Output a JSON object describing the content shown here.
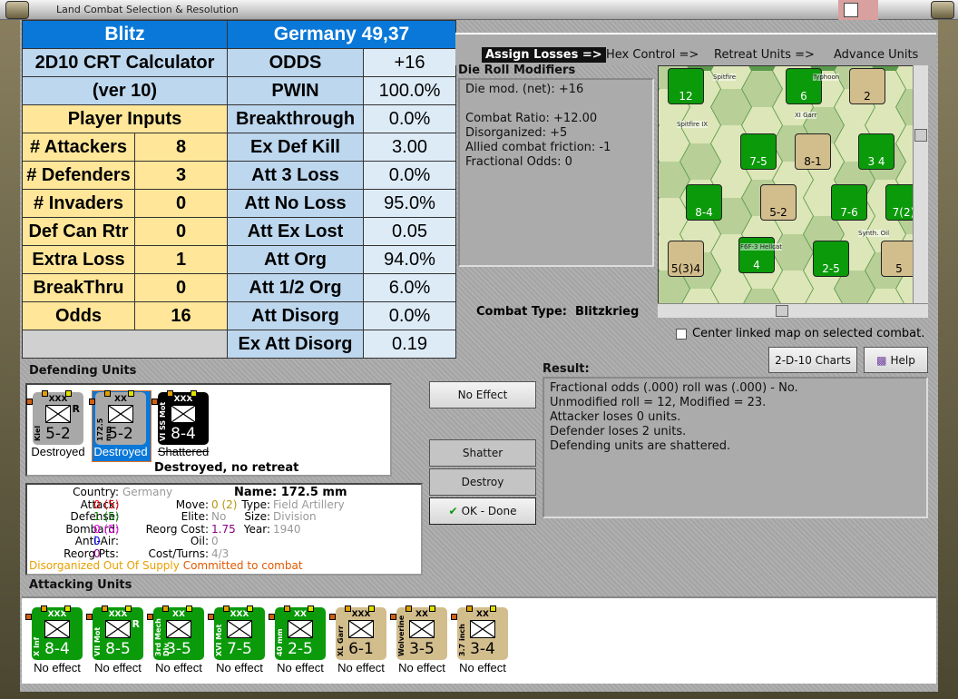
{
  "window": {
    "title": "Land Combat Selection & Resolution"
  },
  "crt": {
    "header_left": "Blitz",
    "header_right": "Germany 49,37",
    "calc_title": "2D10 CRT Calculator",
    "calc_version": "(ver 10)",
    "inputs_header": "Player Inputs",
    "inputs": [
      {
        "label": "# Attackers",
        "value": "8"
      },
      {
        "label": "# Defenders",
        "value": "3"
      },
      {
        "label": "# Invaders",
        "value": "0"
      },
      {
        "label": "Def Can Rtr",
        "value": "0"
      },
      {
        "label": "Extra Loss",
        "value": "1"
      },
      {
        "label": "BreakThru",
        "value": "0"
      },
      {
        "label": "Odds",
        "value": "16"
      }
    ],
    "results": [
      {
        "label": "ODDS",
        "value": "+16"
      },
      {
        "label": "PWIN",
        "value": "100.0%"
      },
      {
        "label": "Breakthrough",
        "value": "0.0%"
      },
      {
        "label": "Ex Def Kill",
        "value": "3.00"
      },
      {
        "label": "Att 3 Loss",
        "value": "0.0%"
      },
      {
        "label": "Att No Loss",
        "value": "95.0%"
      },
      {
        "label": "Att Ex Lost",
        "value": "0.05"
      },
      {
        "label": "Att Org",
        "value": "94.0%"
      },
      {
        "label": "Att 1/2 Org",
        "value": "6.0%"
      },
      {
        "label": "Att Disorg",
        "value": "0.0%"
      },
      {
        "label": "Ex Att Disorg",
        "value": "0.19"
      }
    ]
  },
  "steps": [
    "Assign Losses =>",
    "Hex Control =>",
    "Retreat Units =>",
    "Advance Units"
  ],
  "modifiers": {
    "title": "Die Roll Modifiers",
    "lines": [
      "Die mod. (net): +16",
      "",
      "Combat Ratio: +12.00",
      "Disorganized: +5",
      "Allied combat friction: -1",
      "Fractional Odds: 0"
    ]
  },
  "combat_type": {
    "label": "Combat Type:",
    "value": "Blitzkrieg"
  },
  "center_map": {
    "label": "Center linked map on selected combat.",
    "checked": false
  },
  "buttons": {
    "charts": "2-D-10 Charts",
    "help": "Help",
    "no_effect": "No Effect",
    "shatter": "Shatter",
    "destroy": "Destroy",
    "ok": "OK - Done"
  },
  "result": {
    "title": "Result:",
    "lines": [
      "Fractional odds (.000) roll was (.000)  - No.",
      "Unmodified roll = 12, Modified = 23.",
      "Attacker loses 0 units.",
      "Defender loses 2 units.",
      "Defending units are shattered."
    ]
  },
  "defending": {
    "title": "Defending Units",
    "note": "Destroyed, no retreat",
    "units": [
      {
        "name": "Kiel",
        "size": "XXX",
        "strength": "5-2",
        "status": "Destroyed",
        "reserve": "R",
        "symbol": "M"
      },
      {
        "name": "172.5 mm",
        "size": "XX",
        "strength": "5-2",
        "status": "Destroyed",
        "selected": true
      },
      {
        "name": "VI SS Mot",
        "size": "XXX",
        "strength": "8-4",
        "status": "Shattered"
      }
    ]
  },
  "unit_info": {
    "country": {
      "label": "Country:",
      "value": "Germany"
    },
    "attack": {
      "label": "Attack:",
      "value": "0",
      "base": "(5)"
    },
    "defense": {
      "label": "Defense:",
      "value": "1",
      "base": "(5)"
    },
    "bombard": {
      "label": "Bombard:",
      "value": "0",
      "base": "(5)"
    },
    "anti_air": {
      "label": "Anti-Air:",
      "value": "0"
    },
    "reorg_pts": {
      "label": "Reorg Pts:",
      "value": "0"
    },
    "move": {
      "label": "Move:",
      "value": "0 (2)"
    },
    "elite": {
      "label": "Elite:",
      "value": "No"
    },
    "reorg_cost": {
      "label": "Reorg Cost:",
      "value": "1.75"
    },
    "oil": {
      "label": "Oil:",
      "value": "0"
    },
    "cost_turns": {
      "label": "Cost/Turns:",
      "value": "4/3"
    },
    "name": {
      "label": "Name:",
      "value": "172.5 mm"
    },
    "type": {
      "label": "Type:",
      "value": "Field Artillery"
    },
    "size": {
      "label": "Size:",
      "value": "Division"
    },
    "year": {
      "label": "Year:",
      "value": "1940"
    },
    "status1": "Disorganized Out Of Supply",
    "status2": "Committed to combat"
  },
  "attacking": {
    "title": "Attacking Units",
    "units": [
      {
        "name": "X Inf",
        "size": "XXX",
        "strength": "8-4",
        "status": "No effect",
        "color": "green"
      },
      {
        "name": "VII Mot",
        "size": "XXX",
        "strength": "8-5",
        "status": "No effect",
        "color": "green",
        "reserve": "R"
      },
      {
        "name": "3rd Mech Div",
        "size": "XX",
        "strength": "3-5",
        "status": "No effect",
        "color": "green"
      },
      {
        "name": "XVI Mot",
        "size": "XXX",
        "strength": "7-5",
        "status": "No effect",
        "color": "green"
      },
      {
        "name": "40 mm",
        "size": "XX",
        "strength": "2-5",
        "status": "No effect",
        "color": "green"
      },
      {
        "name": "XL Garr",
        "size": "XXX",
        "strength": "6-1",
        "status": "No effect",
        "color": "tan"
      },
      {
        "name": "Wolverine",
        "size": "XX",
        "strength": "3-5",
        "status": "No effect",
        "color": "tan"
      },
      {
        "name": "3.7 inch",
        "size": "XX",
        "strength": "3-4",
        "status": "No effect",
        "color": "tan"
      }
    ]
  },
  "map": {
    "counters": [
      "7-5",
      "8-1",
      "3 4",
      "8-4",
      "5-2",
      "7-6",
      "7(2)",
      "5(3)4",
      "2-5",
      "4",
      "5",
      "6",
      "12",
      "2"
    ],
    "labels": [
      "Spitfire",
      "Typhoon",
      "Spitfire IX",
      "XI Garr",
      "Synth. Oil",
      "F6F-3 Hellcat"
    ]
  }
}
